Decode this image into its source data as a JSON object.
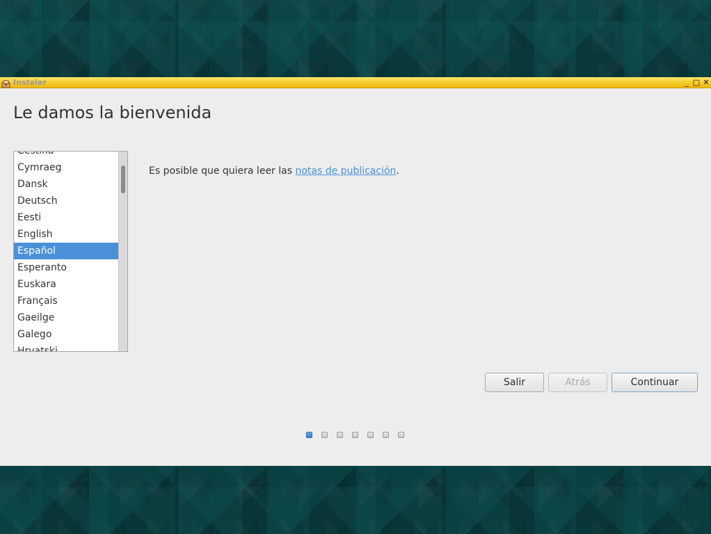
{
  "window": {
    "title": "Instalar",
    "minimize_glyph": "_",
    "maximize_glyph": "□",
    "close_glyph": "✕"
  },
  "page": {
    "heading": "Le damos la bienvenida"
  },
  "languages": {
    "items": [
      "Čeština",
      "Cymraeg",
      "Dansk",
      "Deutsch",
      "Eesti",
      "English",
      "Español",
      "Esperanto",
      "Euskara",
      "Français",
      "Gaeilge",
      "Galego",
      "Hrvatski"
    ],
    "selected": "Español"
  },
  "notes": {
    "prefix": "Es posible que quiera leer las ",
    "link_text": "notas de publicación",
    "suffix": "."
  },
  "buttons": {
    "quit": "Salir",
    "back": "Atrás",
    "continue": "Continuar"
  },
  "progress": {
    "total_steps": 7,
    "current_step": 1
  },
  "colors": {
    "title_bar": "#f6c928",
    "selection": "#4a90d9",
    "link": "#4a90d9",
    "window_bg": "#ededed"
  },
  "icons": {
    "window_icon": "installer-icon"
  }
}
